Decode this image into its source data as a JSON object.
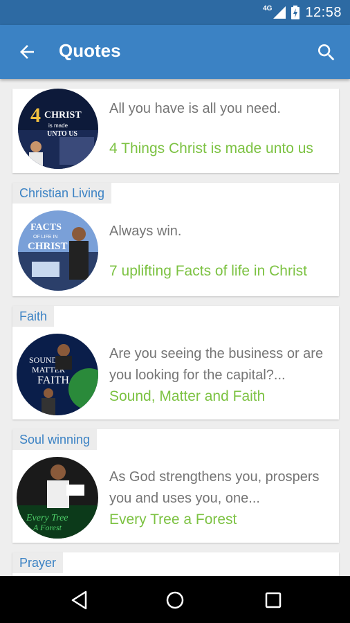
{
  "status_bar": {
    "network": "4G",
    "time": "12:58",
    "icons": [
      "signal-icon",
      "battery-icon"
    ]
  },
  "app_bar": {
    "title": "Quotes",
    "back_icon": "arrow-back-icon",
    "search_icon": "search-icon",
    "color": "#3b82c4"
  },
  "colors": {
    "accent_link": "#7cc242",
    "category_text": "#3b82c4",
    "quote_text": "#757575"
  },
  "cards": [
    {
      "category": "",
      "quote": "All you have is all you need.",
      "link": "4 Things Christ is made unto us",
      "image": "4 Things Christ Is Made Unto Us"
    },
    {
      "category": "Christian Living",
      "quote": "Always win.",
      "link": "7 uplifting Facts of life in Christ",
      "image": "Facts of Life in Christ"
    },
    {
      "category": "Faith",
      "quote": "Are you seeing the business or are you looking for the capital?...",
      "link": "Sound, Matter and Faith",
      "image": "Sound Matter Faith"
    },
    {
      "category": "Soul winning",
      "quote": "As God strengthens you, prospers you and uses you, one...",
      "link": "Every Tree a Forest",
      "image": "Every Tree A Forest"
    },
    {
      "category": "Prayer",
      "quote": "",
      "link": "",
      "image": ""
    }
  ]
}
